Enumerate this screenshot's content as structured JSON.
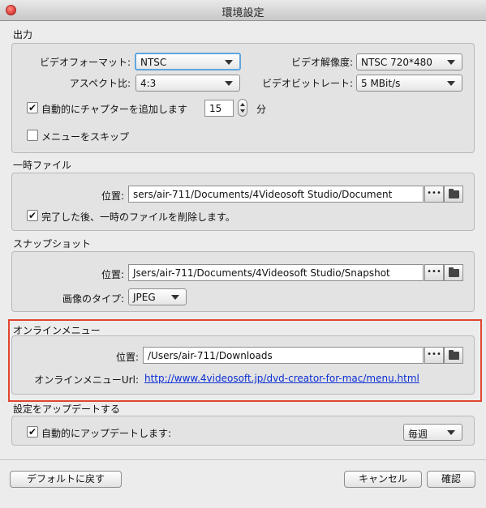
{
  "window": {
    "title": "環境設定"
  },
  "output": {
    "section_title": "出力",
    "video_format_label": "ビデオフォーマット:",
    "video_format_value": "NTSC",
    "video_resolution_label": "ビデオ解像度:",
    "video_resolution_value": "NTSC 720*480",
    "aspect_label": "アスペクト比:",
    "aspect_value": "4:3",
    "bitrate_label": "ビデオビットレート:",
    "bitrate_value": "5 MBit/s",
    "auto_chapter_label": "自動的にチャプターを追加します",
    "auto_chapter_checked": true,
    "chapter_minutes": "15",
    "minutes_unit": "分",
    "skip_menu_label": "メニューをスキップ",
    "skip_menu_checked": false
  },
  "temp": {
    "section_title": "一時ファイル",
    "location_label": "位置:",
    "location_value": "sers/air-711/Documents/4Videosoft Studio/Document",
    "browse_label": "•••",
    "delete_after_label": "完了した後、一時のファイルを削除します。",
    "delete_after_checked": true
  },
  "snapshot": {
    "section_title": "スナップショット",
    "location_label": "位置:",
    "location_value": "Jsers/air-711/Documents/4Videosoft Studio/Snapshot",
    "browse_label": "•••",
    "image_type_label": "画像のタイプ:",
    "image_type_value": "JPEG"
  },
  "online_menu": {
    "section_title": "オンラインメニュー",
    "location_label": "位置:",
    "location_value": "/Users/air-711/Downloads",
    "browse_label": "•••",
    "url_label": "オンラインメニューUrl:",
    "url_value": "http://www.4videosoft.jp/dvd-creator-for-mac/menu.html"
  },
  "update": {
    "section_title": "設定をアップデートする",
    "auto_update_label": "自動的にアップデートします:",
    "auto_update_checked": true,
    "frequency_value": "毎週"
  },
  "footer": {
    "default_button": "デフォルトに戻す",
    "cancel_button": "キャンセル",
    "ok_button": "確認"
  },
  "colors": {
    "highlight": "#e2452f",
    "link": "#0b2fd4",
    "focus": "#5fa5df"
  }
}
